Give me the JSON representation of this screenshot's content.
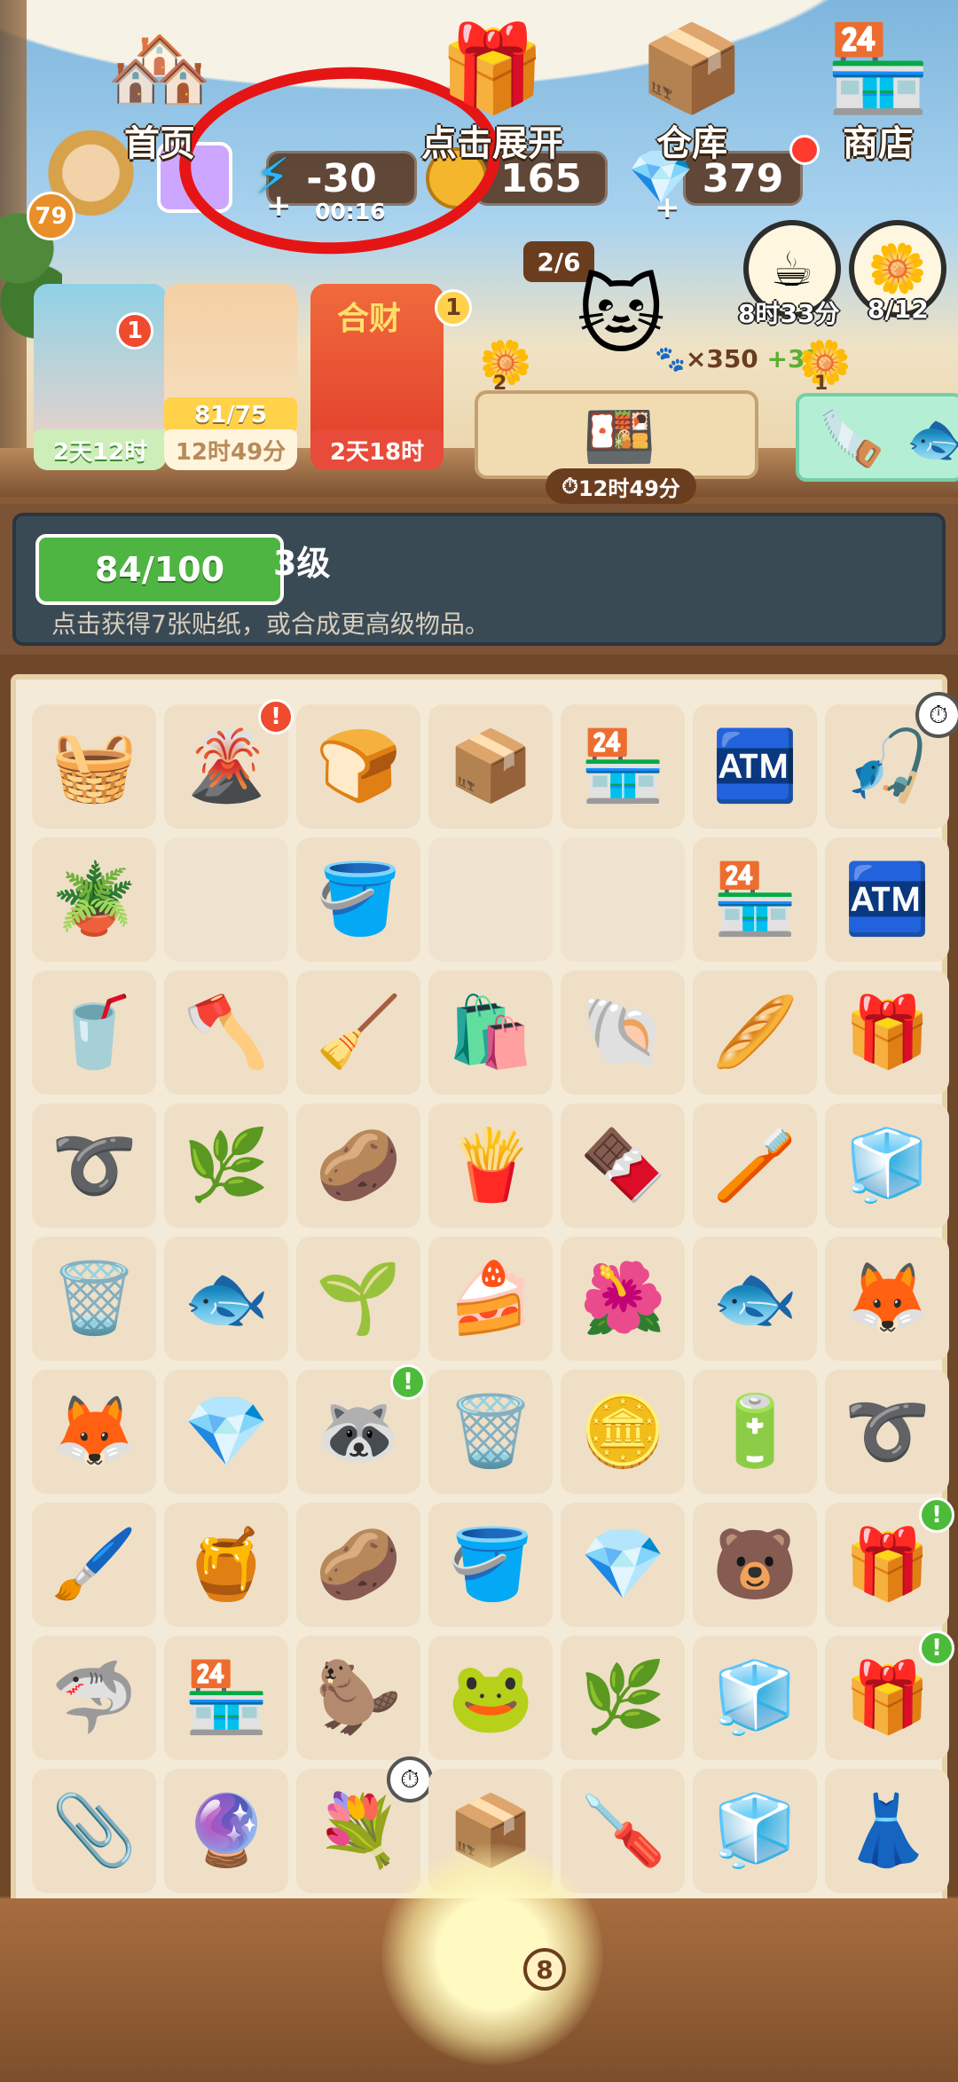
{
  "hud": {
    "player_level": "79",
    "energy_value": "-30",
    "energy_timer": "00:16",
    "coins": "165",
    "gems": "379",
    "plus": "+",
    "tea_timer": "8时33分",
    "flower_progress": "8/12"
  },
  "characters": [
    {
      "timer": "2天12时",
      "badge": "1",
      "color": "#7fd36b"
    },
    {
      "progress": "81/75",
      "timer": "12时49分",
      "color": "#f3e7c7"
    },
    {
      "timer": "2天18时",
      "badge": "1",
      "color": "#e84b3a",
      "sign": "合财"
    }
  ],
  "cat_order": {
    "progress": "2/6",
    "paw_value": "×350",
    "bonus": "+35",
    "flower_count_left": "2",
    "flower_count_right": "1",
    "timer": "12时49分"
  },
  "level_banner": {
    "progress": "84/100",
    "title": "3级",
    "description": "点击获得7张贴纸，或合成更高级物品。"
  },
  "board": {
    "rows": [
      [
        "🧺",
        "🌋",
        "🍞",
        "📦",
        "🏪",
        "🏧",
        "🎣"
      ],
      [
        "🪴",
        "",
        "🪣",
        "",
        "",
        "🏪",
        "🏧"
      ],
      [
        "🥤",
        "🪓",
        "🧹",
        "🛍️",
        "🐚",
        "🥖",
        "🎁"
      ],
      [
        "➰",
        "🌿",
        "🥔",
        "🍟",
        "🍫",
        "🪥",
        "🧊"
      ],
      [
        "🗑️",
        "🐟",
        "🌱",
        "🍰",
        "🌺",
        "🐟",
        "🦊"
      ],
      [
        "🦊",
        "💎",
        "🦝",
        "🗑️",
        "🪙",
        "🔋",
        "➰"
      ],
      [
        "🖌️",
        "🍯",
        "🥔",
        "🪣",
        "💎",
        "🐻",
        "🎁"
      ],
      [
        "🦈",
        "🏪",
        "🦫",
        "🐸",
        "🌿",
        "🧊",
        "🎁"
      ],
      [
        "📎",
        "🔮",
        "💐",
        "📦",
        "🪛",
        "🧊",
        "👗"
      ]
    ]
  },
  "bottom_nav": {
    "home": "首页",
    "expand": "点击展开",
    "expand_count": "8",
    "storage": "仓库",
    "shop": "商店"
  }
}
